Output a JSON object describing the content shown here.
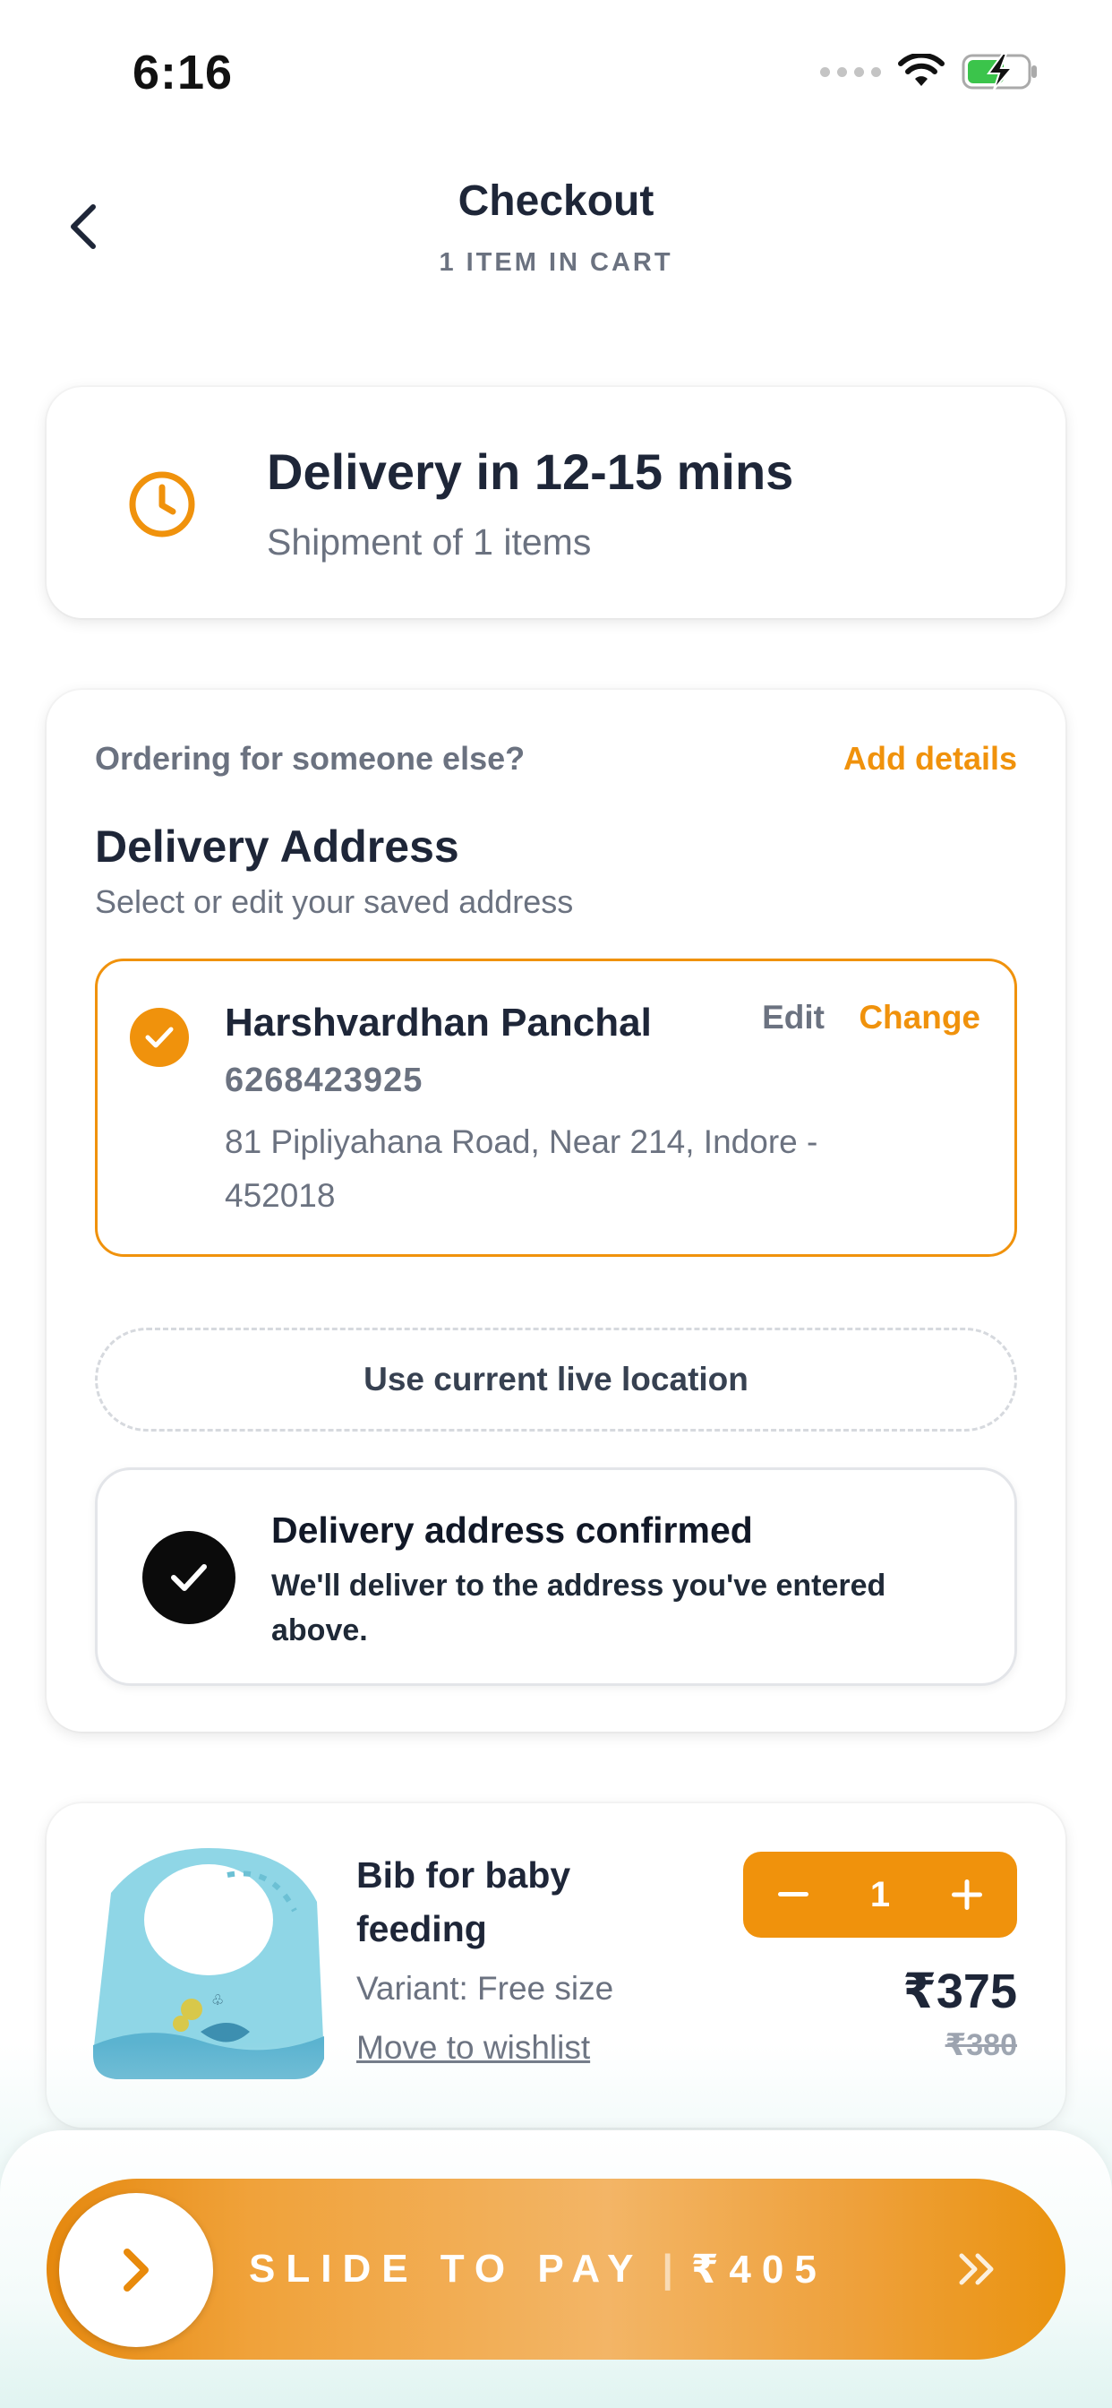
{
  "status_bar": {
    "time": "6:16"
  },
  "header": {
    "title": "Checkout",
    "subtitle": "1 ITEM IN CART"
  },
  "delivery": {
    "title": "Delivery in 12-15 mins",
    "subtitle": "Shipment of 1 items"
  },
  "address_section": {
    "ordering_prompt": "Ordering for someone else?",
    "add_details": "Add details",
    "title": "Delivery Address",
    "subtitle": "Select or edit your saved address",
    "selected_address": {
      "name": "Harshvardhan Panchal",
      "phone": "6268423925",
      "line": "81 Pipliyahana Road, Near 214, Indore - 452018",
      "edit_label": "Edit",
      "change_label": "Change"
    },
    "live_location_label": "Use current live location",
    "confirmation": {
      "title": "Delivery address confirmed",
      "subtitle": "We'll deliver to the address you've entered above."
    }
  },
  "cart_item": {
    "name": "Bib for baby feeding",
    "variant": "Variant: Free size",
    "wishlist_label": "Move to wishlist",
    "quantity": "1",
    "price": "₹375",
    "mrp": "₹380"
  },
  "pay_slider": {
    "label": "SLIDE TO PAY",
    "separator": "|",
    "amount": "₹405"
  },
  "colors": {
    "accent": "#f0920c",
    "text_dark": "#1e2638",
    "text_muted": "#6b7280"
  },
  "icons": {
    "back": "chevron-left-icon",
    "clock": "clock-icon",
    "check": "check-icon",
    "minus": "minus-icon",
    "plus": "plus-icon",
    "slider_arrow": "chevron-right-icon",
    "double_arrow": "double-chevron-right-icon"
  }
}
